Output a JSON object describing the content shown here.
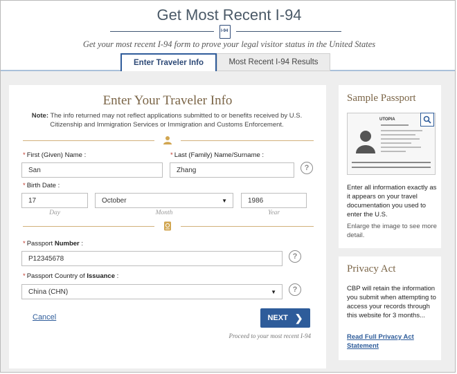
{
  "header": {
    "title": "Get Most Recent I-94",
    "doc_icon_label": "I-94",
    "subtitle": "Get your most recent I-94 form to prove your legal visitor status in the United States"
  },
  "tabs": [
    {
      "label": "Enter Traveler Info",
      "active": true
    },
    {
      "label": "Most Recent I-94 Results",
      "active": false
    }
  ],
  "form": {
    "title": "Enter Your Traveler Info",
    "note_label": "Note:",
    "note_text": "The info returned may not reflect applications submitted to or benefits received by U.S. Citizenship and Immigration Services or Immigration and Customs Enforcement.",
    "first_name_label": "First (Given) Name :",
    "first_name_value": "San",
    "last_name_label": "Last (Family) Name/Surname :",
    "last_name_value": "Zhang",
    "birth_date_label": "Birth Date :",
    "birth_day_value": "17",
    "birth_month_value": "October",
    "birth_year_value": "1986",
    "day_label": "Day",
    "month_label": "Month",
    "year_label": "Year",
    "passport_number_label_pre": "Passport ",
    "passport_number_label_bold": "Number",
    "passport_number_label_post": " :",
    "passport_number_value": "P12345678",
    "passport_country_label_pre": "Passport Country of ",
    "passport_country_label_bold": "Issuance",
    "passport_country_label_post": " :",
    "passport_country_value": "China (CHN)",
    "help_glyph": "?",
    "required_mark": "*",
    "cancel_label": "Cancel",
    "next_label": "NEXT",
    "proceed_text": "Proceed to your most recent I-94"
  },
  "sidebar": {
    "sample_title": "Sample Passport",
    "passport_country": "UTOPIA",
    "sample_text": "Enter all information exactly as it appears on your travel documentation you used to enter the U.S.",
    "enlarge_text": "Enlarge the image to see more detail.",
    "privacy_title": "Privacy Act",
    "privacy_text": "CBP will retain the information you submit when attempting to access your records through this website for 3 months...",
    "privacy_link": "Read Full Privacy Act Statement"
  },
  "colors": {
    "accent_blue": "#2e5c9a",
    "gold": "#d1b07a",
    "required_red": "#c0392b"
  },
  "icons": [
    "document-icon",
    "person-icon",
    "passport-icon",
    "help-icon",
    "chevron-right-icon",
    "chevron-down-icon",
    "magnify-icon"
  ]
}
